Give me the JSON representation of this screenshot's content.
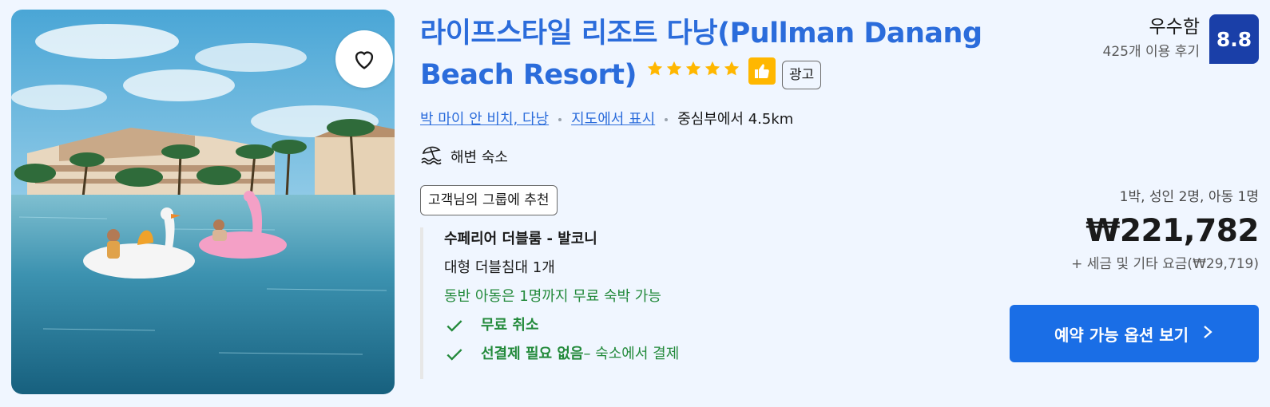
{
  "hotel": {
    "name": "라이프스타일 리조트 다낭(Pullman Danang Beach Resort)",
    "star_count": 5,
    "ad_label": "광고",
    "location_link": "박 마이 안 비치, 다낭",
    "map_link": "지도에서 표시",
    "distance": "중심부에서 4.5km",
    "beach_label": "해변 숙소",
    "recommend_badge": "고객님의 그룹에 추천"
  },
  "room": {
    "name": "수페리어 더블룸 - 발코니",
    "bed": "대형 더블침대 1개",
    "child_note": "동반 아동은 1명까지 무료 숙박 가능",
    "benefit_1": "무료 취소",
    "benefit_2_bold": "선결제 필요 없음",
    "benefit_2_rest": " – 숙소에서 결제"
  },
  "review": {
    "word": "우수함",
    "count": "425개 이용 후기",
    "score": "8.8"
  },
  "pricing": {
    "guests": "1박, 성인 2명, 아동 1명",
    "price": "₩221,782",
    "tax": "+ 세금 및 기타 요금(₩29,719)"
  },
  "cta": {
    "label": "예약 가능 옵션 보기"
  },
  "colors": {
    "link": "#2b6cdb",
    "star": "#ffb700",
    "score_bg": "#1a3fa8",
    "cta_bg": "#1a6ee6",
    "green": "#238a3b"
  },
  "icons": [
    "heart-icon",
    "star-icon",
    "thumbs-up-icon",
    "beach-umbrella-icon",
    "check-icon",
    "chevron-right-icon"
  ]
}
